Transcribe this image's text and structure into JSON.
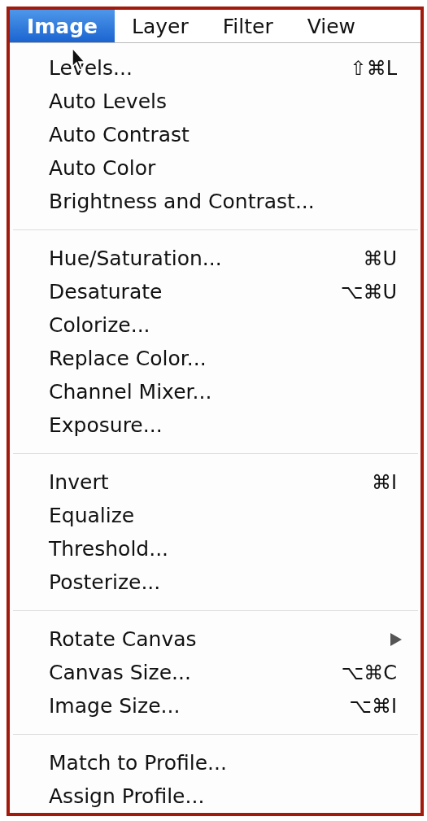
{
  "menubar": [
    {
      "label": "Image",
      "selected": true
    },
    {
      "label": "Layer",
      "selected": false
    },
    {
      "label": "Filter",
      "selected": false
    },
    {
      "label": "View",
      "selected": false
    }
  ],
  "menu": {
    "groups": [
      [
        {
          "kind": "command",
          "label": "Levels...",
          "shortcut": "⇧⌘L"
        },
        {
          "kind": "command",
          "label": "Auto Levels"
        },
        {
          "kind": "command",
          "label": "Auto Contrast"
        },
        {
          "kind": "command",
          "label": "Auto Color"
        },
        {
          "kind": "command",
          "label": "Brightness and Contrast..."
        }
      ],
      [
        {
          "kind": "command",
          "label": "Hue/Saturation...",
          "shortcut": "⌘U"
        },
        {
          "kind": "command",
          "label": "Desaturate",
          "shortcut": "⌥⌘U"
        },
        {
          "kind": "command",
          "label": "Colorize..."
        },
        {
          "kind": "command",
          "label": "Replace Color..."
        },
        {
          "kind": "command",
          "label": "Channel Mixer..."
        },
        {
          "kind": "command",
          "label": "Exposure..."
        }
      ],
      [
        {
          "kind": "command",
          "label": "Invert",
          "shortcut": "⌘I"
        },
        {
          "kind": "command",
          "label": "Equalize"
        },
        {
          "kind": "command",
          "label": "Threshold..."
        },
        {
          "kind": "command",
          "label": "Posterize..."
        }
      ],
      [
        {
          "kind": "submenu",
          "label": "Rotate Canvas"
        },
        {
          "kind": "command",
          "label": "Canvas Size...",
          "shortcut": "⌥⌘C"
        },
        {
          "kind": "command",
          "label": "Image Size...",
          "shortcut": "⌥⌘I"
        }
      ],
      [
        {
          "kind": "command",
          "label": "Match to Profile..."
        },
        {
          "kind": "command",
          "label": "Assign Profile..."
        }
      ]
    ]
  }
}
